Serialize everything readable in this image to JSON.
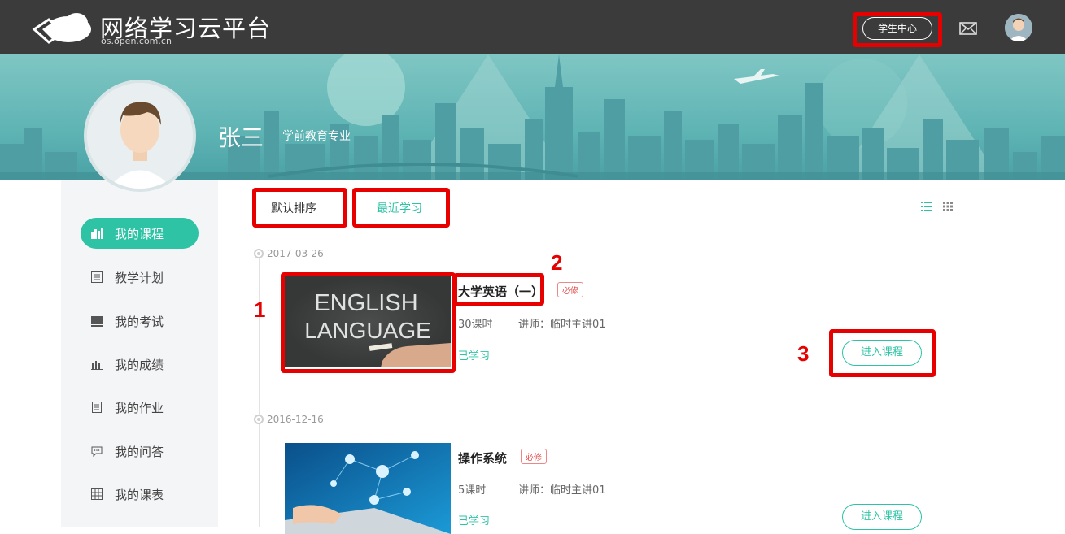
{
  "header": {
    "app_title": "网络学习云平台",
    "app_subtitle": "os.open.com.cn",
    "student_center_label": "学生中心"
  },
  "profile": {
    "name": "张三",
    "major": "学前教育专业"
  },
  "sidebar": {
    "items": [
      {
        "label": "我的课程",
        "icon": "bar-chart-icon",
        "active": true
      },
      {
        "label": "教学计划",
        "icon": "calendar-icon",
        "active": false
      },
      {
        "label": "我的考试",
        "icon": "exam-icon",
        "active": false
      },
      {
        "label": "我的成绩",
        "icon": "grade-chart-icon",
        "active": false
      },
      {
        "label": "我的作业",
        "icon": "document-icon",
        "active": false
      },
      {
        "label": "我的问答",
        "icon": "chat-icon",
        "active": false
      },
      {
        "label": "我的课表",
        "icon": "grid-table-icon",
        "active": false
      }
    ]
  },
  "sort": {
    "default_label": "默认排序",
    "recent_label": "最近学习"
  },
  "courses": [
    {
      "date": "2017-03-26",
      "title": "大学英语（一）",
      "tag": "必修",
      "hours": "30课时",
      "teacher": "讲师：临时主讲01",
      "status": "已学习",
      "enter_label": "进入课程",
      "thumb_line1": "ENGLISH",
      "thumb_line2": "LANGUAGE"
    },
    {
      "date": "2016-12-16",
      "title": "操作系统",
      "tag": "必修",
      "hours": "5课时",
      "teacher": "讲师：临时主讲01",
      "status": "已学习",
      "enter_label": "进入课程"
    }
  ],
  "annotations": {
    "n1": "1",
    "n2": "2",
    "n3": "3"
  },
  "colors": {
    "accent": "#2fc3a6",
    "highlight": "#e60000",
    "topbar": "#3b3b3b",
    "banner": "#5fb4b4"
  }
}
